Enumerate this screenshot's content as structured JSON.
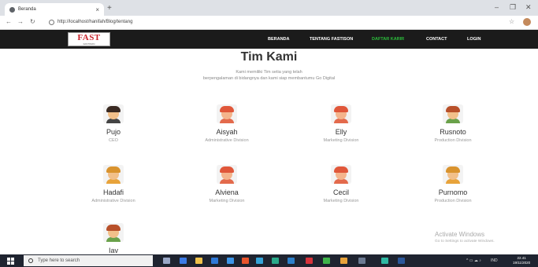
{
  "browser": {
    "tab_title": "Beranda",
    "tab_close": "×",
    "new_tab": "+",
    "url": "http://localhost/hanifah/Blog/tentang",
    "controls": {
      "minimize": "–",
      "maximize": "❐",
      "close": "✕"
    }
  },
  "site": {
    "logo_text": "FAST",
    "logo_sub": "FASTISON",
    "nav": [
      "BERANDA",
      "TENTANG FASTISON",
      "DAFTAR KARIR",
      "CONTACT",
      "LOGIN"
    ],
    "active_nav": "DAFTAR KARIR",
    "active_color": "#2cbf3c"
  },
  "content": {
    "heading": "Tim Kami",
    "subtitle_line1": "Kami memiliki Tim setia yang telah",
    "subtitle_line2": "berpengalaman di bidangnya dan kami siap membantumu Go Digital"
  },
  "members": [
    {
      "name": "Pujo",
      "role": "CEO",
      "icon": "man-sunglasses-avatar-icon"
    },
    {
      "name": "Aisyah",
      "role": "Administrative Division",
      "icon": "woman-avatar-icon"
    },
    {
      "name": "Elly",
      "role": "Marketing Division",
      "icon": "woman-avatar-icon"
    },
    {
      "name": "Rusnoto",
      "role": "Production Division",
      "icon": "man-mustache-avatar-icon"
    },
    {
      "name": "Hadafi",
      "role": "Administrative Division",
      "icon": "man-avatar-icon"
    },
    {
      "name": "Alviena",
      "role": "Marketing Division",
      "icon": "woman-avatar-icon"
    },
    {
      "name": "Cecil",
      "role": "Marketing Division",
      "icon": "woman-avatar-icon"
    },
    {
      "name": "Purnomo",
      "role": "Production Division",
      "icon": "man-avatar-icon"
    },
    {
      "name": "Iav",
      "role": "",
      "icon": "man-mustache-avatar-icon"
    }
  ],
  "watermark": {
    "title": "Activate Windows",
    "subtitle": "Go to Settings to activate Windows."
  },
  "taskbar": {
    "search_placeholder": "Type here to search",
    "tray_lang": "IND",
    "time": "22.41",
    "date": "19/11/2020"
  }
}
